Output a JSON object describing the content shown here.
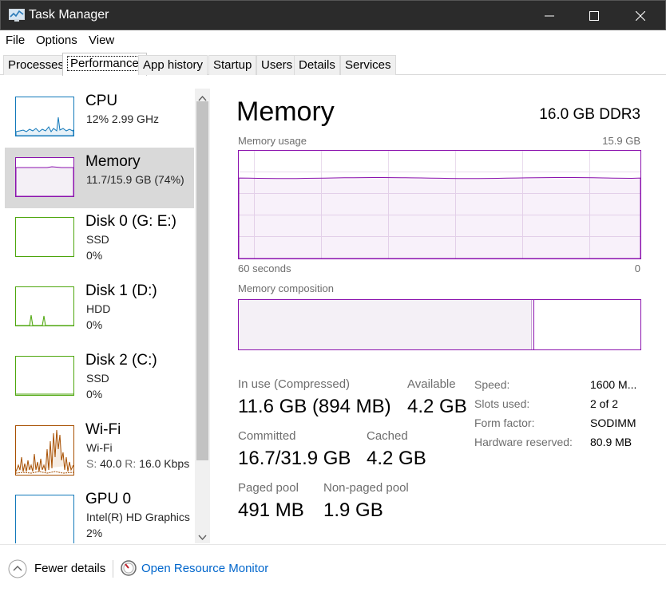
{
  "window": {
    "title": "Task Manager"
  },
  "menu": {
    "file": "File",
    "options": "Options",
    "view": "View"
  },
  "tabs": [
    "Processes",
    "Performance",
    "App history",
    "Startup",
    "Users",
    "Details",
    "Services"
  ],
  "active_tab": "Performance",
  "sidebar": {
    "items": [
      {
        "title": "CPU",
        "sub1": "12%  2.99 GHz",
        "sub2": ""
      },
      {
        "title": "Memory",
        "sub1": "11.7/15.9 GB (74%)",
        "sub2": ""
      },
      {
        "title": "Disk 0 (G: E:)",
        "sub1": "SSD",
        "sub2": "0%"
      },
      {
        "title": "Disk 1 (D:)",
        "sub1": "HDD",
        "sub2": "0%"
      },
      {
        "title": "Disk 2 (C:)",
        "sub1": "SSD",
        "sub2": "0%"
      },
      {
        "title": "Wi-Fi",
        "sub1": "Wi-Fi",
        "sub2_s_label": "S:",
        "sub2_s_val": "40.0",
        "sub2_r_label": "R:",
        "sub2_r_val": "16.0 Kbps"
      },
      {
        "title": "GPU 0",
        "sub1": "Intel(R) HD Graphics",
        "sub2": "2%"
      }
    ],
    "selected": "Memory"
  },
  "main": {
    "heading": "Memory",
    "spec": "16.0 GB DDR3",
    "usage_label": "Memory usage",
    "usage_max": "15.9 GB",
    "time_left": "60 seconds",
    "time_right": "0",
    "composition_label": "Memory composition",
    "usage_level": 0.74,
    "composition_in_use": 0.73,
    "stats": {
      "in_use_label": "In use (Compressed)",
      "in_use_value": "11.6 GB (894 MB)",
      "available_label": "Available",
      "available_value": "4.2 GB",
      "committed_label": "Committed",
      "committed_value": "16.7/31.9 GB",
      "cached_label": "Cached",
      "cached_value": "4.2 GB",
      "paged_label": "Paged pool",
      "paged_value": "491 MB",
      "nonpaged_label": "Non-paged pool",
      "nonpaged_value": "1.9 GB"
    },
    "specs": {
      "speed_label": "Speed:",
      "speed_value": "1600 M...",
      "slots_label": "Slots used:",
      "slots_value": "2 of 2",
      "form_label": "Form factor:",
      "form_value": "SODIMM",
      "reserved_label": "Hardware reserved:",
      "reserved_value": "80.9 MB"
    }
  },
  "footer": {
    "fewer_details": "Fewer details",
    "open_monitor": "Open Resource Monitor"
  },
  "colors": {
    "memory_accent": "#8b12ae",
    "cpu_accent": "#1178ba",
    "disk_accent": "#4da60c",
    "wifi_accent": "#a74f01",
    "link": "#0066cc"
  }
}
